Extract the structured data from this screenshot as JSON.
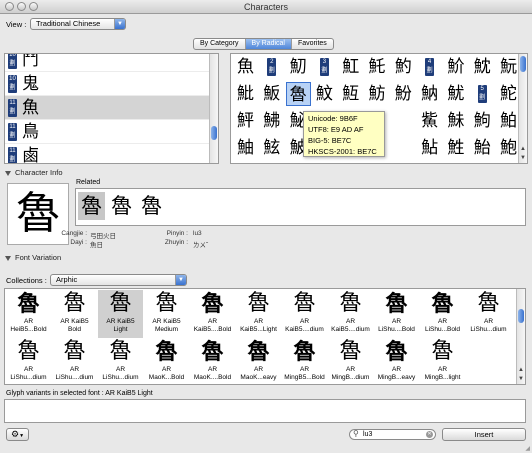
{
  "window": {
    "title": "Characters"
  },
  "view": {
    "label": "View :",
    "selected": "Traditional Chinese"
  },
  "tabs": [
    {
      "label": "By Category",
      "selected": false
    },
    {
      "label": "By Radical",
      "selected": true
    },
    {
      "label": "Favorites",
      "selected": false
    }
  ],
  "radicals": [
    {
      "strokes": "10",
      "unit": "劃",
      "glyph": "鬥"
    },
    {
      "strokes": "10",
      "unit": "劃",
      "glyph": "鬼"
    },
    {
      "strokes": "11",
      "unit": "劃",
      "glyph": "魚",
      "selected": true
    },
    {
      "strokes": "11",
      "unit": "劃",
      "glyph": "鳥"
    },
    {
      "strokes": "11",
      "unit": "劃",
      "glyph": "鹵"
    }
  ],
  "char_grid": {
    "rows": [
      [
        "魚",
        "#2",
        "魛",
        "#3",
        "魟",
        "魠",
        "魡",
        "#4",
        "魪",
        "魫",
        "魭"
      ],
      [
        "魮",
        "魬",
        "魯",
        "魰",
        "魱",
        "魴",
        "魵",
        "魶",
        "魷",
        "#5",
        "鮀"
      ],
      [
        "鮃",
        "鮄",
        "鮅",
        "",
        "",
        "",
        "",
        "鮆",
        "鮇",
        "鮈",
        "鮊"
      ],
      [
        "鮋",
        "鮌",
        "鮍",
        "",
        "",
        "",
        "",
        "鮎",
        "鮏",
        "鮐",
        "鮑"
      ]
    ],
    "badge_unit": "劃",
    "selected_glyph": "魯"
  },
  "tooltip": {
    "lines": [
      "Unicode: 9B6F",
      "UTF8: E9 AD AF",
      "BIG-5: BE7C",
      "HKSCS-2001: BE7C"
    ]
  },
  "character_info": {
    "section_label": "Character Info",
    "glyph": "魯",
    "related_label": "Related",
    "related": [
      "魯",
      "魯",
      "魯"
    ],
    "cangjie_label": "Cangjie :",
    "cangjie_value": "弓田火日",
    "pinyin_label": "Pinyin :",
    "pinyin_value": "lu3",
    "dayi_label": "Dayi :",
    "dayi_value": "魚日",
    "zhuyin_label": "Zhuyin :",
    "zhuyin_value": "ㄌㄨˇ"
  },
  "font_variation": {
    "section_label": "Font Variation",
    "collections_label": "Collections :",
    "collection_selected": "Arphic",
    "glyph": "魯",
    "fonts": [
      [
        "AR",
        "HeiB5...Bold"
      ],
      [
        "AR KaiB5",
        "Bold"
      ],
      [
        "AR KaiB5",
        "Light"
      ],
      [
        "AR KaiB5",
        "Medium"
      ],
      [
        "AR",
        "KaiB5....Bold"
      ],
      [
        "AR",
        "KaiB5...Light"
      ],
      [
        "AR",
        "KaiB5....dium"
      ],
      [
        "AR",
        "KaiB5....dium"
      ],
      [
        "AR",
        "LiShu....Bold"
      ],
      [
        "AR",
        "LiShu...Bold"
      ],
      [
        "AR",
        "LiShu...dium"
      ],
      [
        "AR",
        "LiShu...dium"
      ],
      [
        "AR",
        "LiShu....dium"
      ],
      [
        "AR",
        "LiShu...dium"
      ],
      [
        "AR",
        "MaoK...Bold"
      ],
      [
        "AR",
        "MaoK....Bold"
      ],
      [
        "AR",
        "MaoK...eavy"
      ],
      [
        "AR",
        "MingB5...Bold"
      ],
      [
        "AR",
        "MingB...dium"
      ],
      [
        "AR",
        "MingB...eavy"
      ],
      [
        "AR",
        "MingB...light"
      ]
    ],
    "selected_index": 2
  },
  "glyph_variants": {
    "label": "Glyph variants in selected font :",
    "font": "AR KaiB5 Light"
  },
  "bottom": {
    "search_value": "lu3",
    "insert_label": "Insert",
    "action_icon": "gear-icon"
  },
  "colors": {
    "selection": "#3a72cf",
    "badge": "#1f3d7a",
    "tooltip_bg": "#ffffc2"
  }
}
